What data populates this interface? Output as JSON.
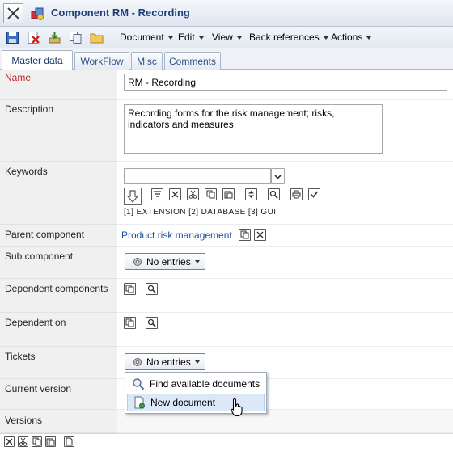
{
  "window": {
    "title": "Component RM - Recording"
  },
  "toolbar": {
    "menus": [
      {
        "label": "Document"
      },
      {
        "label": "Edit"
      },
      {
        "label": "View"
      },
      {
        "label": "Back references"
      },
      {
        "label": "Actions"
      }
    ]
  },
  "tabs": [
    {
      "label": "Master data",
      "active": true
    },
    {
      "label": "WorkFlow",
      "active": false
    },
    {
      "label": "Misc",
      "active": false
    },
    {
      "label": "Comments",
      "active": false
    }
  ],
  "form": {
    "name": {
      "label": "Name",
      "value": "RM - Recording"
    },
    "description": {
      "label": "Description",
      "value": "Recording forms for the risk management; risks, indicators and measures"
    },
    "keywords": {
      "label": "Keywords",
      "value": "",
      "tags": [
        {
          "index": "[1]",
          "text": "EXTENSION"
        },
        {
          "index": "[2]",
          "text": "DATABASE"
        },
        {
          "index": "[3]",
          "text": "GUI"
        }
      ]
    },
    "parent_component": {
      "label": "Parent component",
      "value": "Product risk management"
    },
    "sub_component": {
      "label": "Sub component",
      "button": "No entries"
    },
    "dependent_components": {
      "label": "Dependent components"
    },
    "dependent_on": {
      "label": "Dependent on"
    },
    "tickets": {
      "label": "Tickets",
      "button": "No entries"
    },
    "current_version": {
      "label": "Current version"
    },
    "versions": {
      "label": "Versions"
    }
  },
  "popup_menu": {
    "items": [
      {
        "label": "Find available documents",
        "highlighted": false
      },
      {
        "label": "New document",
        "highlighted": true
      }
    ]
  },
  "colors": {
    "title_text": "#1f3d7a",
    "required_label": "#c0282d",
    "link": "#1b4fa3",
    "label_column": "#f0f0f0"
  }
}
